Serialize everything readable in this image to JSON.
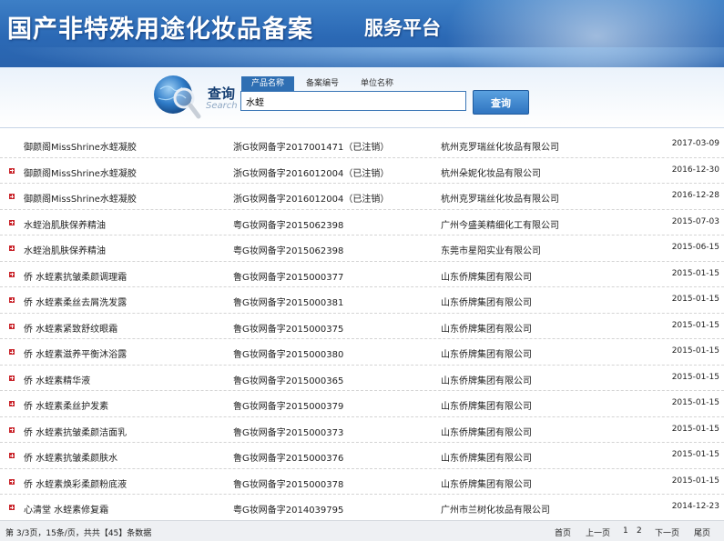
{
  "banner": {
    "title": "国产非特殊用途化妆品备案",
    "subtitle": "服务平台"
  },
  "search": {
    "label": "查询",
    "label_en": "Search",
    "tabs": [
      "产品名称",
      "备案编号",
      "单位名称"
    ],
    "active_tab": 0,
    "value": "水蛭",
    "button": "查询"
  },
  "colors": {
    "banner": "#2b69b5",
    "accent": "#2f6fb3",
    "bullet": "#c9242b"
  },
  "rows": [
    {
      "bullet": false,
      "name": "御颜阁MissShrine水蛭凝胶",
      "reg": "浙G妆网备字2017001471（已注销）",
      "company": "杭州克罗瑞丝化妆品有限公司",
      "date": "2017-03-09"
    },
    {
      "bullet": true,
      "name": "御颜阁MissShrine水蛭凝胶",
      "reg": "浙G妆网备字2016012004（已注销）",
      "company": "杭州朵妮化妆品有限公司",
      "date": "2016-12-30"
    },
    {
      "bullet": true,
      "name": "御颜阁MissShrine水蛭凝胶",
      "reg": "浙G妆网备字2016012004（已注销）",
      "company": "杭州克罗瑞丝化妆品有限公司",
      "date": "2016-12-28"
    },
    {
      "bullet": true,
      "name": "水蛭治肌肤保养精油",
      "reg": "粤G妆网备字2015062398",
      "company": "广州今盛美精细化工有限公司",
      "date": "2015-07-03"
    },
    {
      "bullet": true,
      "name": "水蛭治肌肤保养精油",
      "reg": "粤G妆网备字2015062398",
      "company": "东莞市星阳实业有限公司",
      "date": "2015-06-15"
    },
    {
      "bullet": true,
      "name": "侨 水蛭素抗皱柔颜调理霜",
      "reg": "鲁G妆网备字2015000377",
      "company": "山东侨牌集团有限公司",
      "date": "2015-01-15"
    },
    {
      "bullet": true,
      "name": "侨 水蛭素柔丝去屑洗发露",
      "reg": "鲁G妆网备字2015000381",
      "company": "山东侨牌集团有限公司",
      "date": "2015-01-15"
    },
    {
      "bullet": true,
      "name": "侨 水蛭素紧致舒纹眼霜",
      "reg": "鲁G妆网备字2015000375",
      "company": "山东侨牌集团有限公司",
      "date": "2015-01-15"
    },
    {
      "bullet": true,
      "name": "侨 水蛭素滋养平衡沐浴露",
      "reg": "鲁G妆网备字2015000380",
      "company": "山东侨牌集团有限公司",
      "date": "2015-01-15"
    },
    {
      "bullet": true,
      "name": "侨 水蛭素精华液",
      "reg": "鲁G妆网备字2015000365",
      "company": "山东侨牌集团有限公司",
      "date": "2015-01-15"
    },
    {
      "bullet": true,
      "name": "侨 水蛭素柔丝护发素",
      "reg": "鲁G妆网备字2015000379",
      "company": "山东侨牌集团有限公司",
      "date": "2015-01-15"
    },
    {
      "bullet": true,
      "name": "侨 水蛭素抗皱柔颜洁面乳",
      "reg": "鲁G妆网备字2015000373",
      "company": "山东侨牌集团有限公司",
      "date": "2015-01-15"
    },
    {
      "bullet": true,
      "name": "侨 水蛭素抗皱柔颜肤水",
      "reg": "鲁G妆网备字2015000376",
      "company": "山东侨牌集团有限公司",
      "date": "2015-01-15"
    },
    {
      "bullet": true,
      "name": "侨 水蛭素焕彩柔颜粉底液",
      "reg": "鲁G妆网备字2015000378",
      "company": "山东侨牌集团有限公司",
      "date": "2015-01-15"
    },
    {
      "bullet": true,
      "name": "心清堂 水蛭素修复霜",
      "reg": "粤G妆网备字2014039795",
      "company": "广州市兰树化妆品有限公司",
      "date": "2014-12-23"
    }
  ],
  "footer": {
    "info": "第 3/3页，15条/页，共共【45】条数据",
    "first": "首页",
    "prev": "上一页",
    "page1": "1",
    "page2": "2",
    "next": "下一页",
    "last": "尾页"
  }
}
